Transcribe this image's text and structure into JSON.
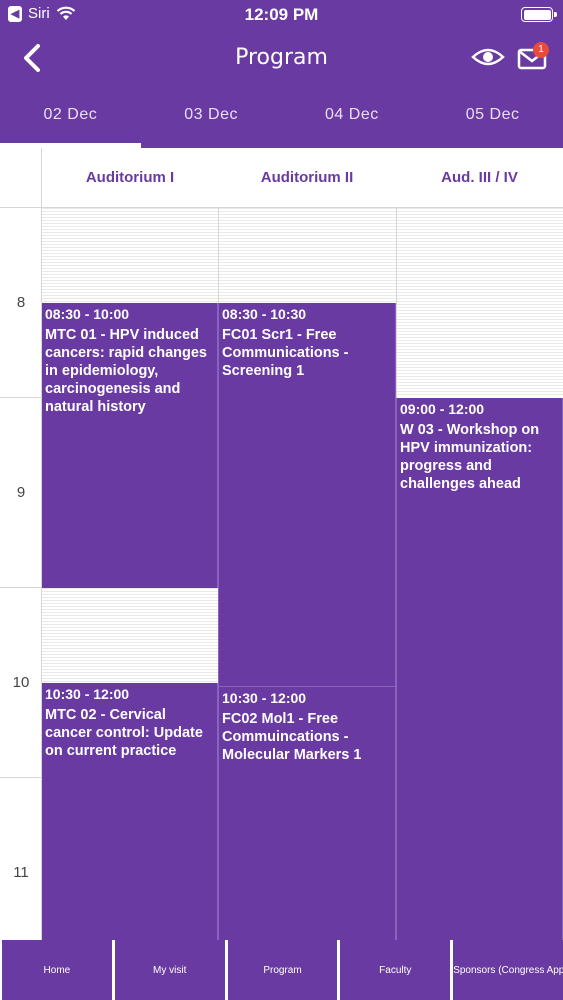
{
  "status_bar": {
    "carrier": "Siri",
    "time": "12:09 PM"
  },
  "header": {
    "title": "Program",
    "notification_count": "1"
  },
  "date_tabs": [
    "02 Dec",
    "03 Dec",
    "04 Dec",
    "05 Dec"
  ],
  "auditoriums": [
    "Auditorium I",
    "Auditorium II",
    "Aud. III / IV"
  ],
  "hours": [
    "8",
    "9",
    "10",
    "11"
  ],
  "events": [
    {
      "time": "08:30 - 10:00",
      "title": "MTC 01 - HPV induced cancers: rapid changes in epidemiology, carcinogenesis and natural history"
    },
    {
      "time": "10:30 - 12:00",
      "title": "MTC 02 - Cervical cancer control: Update on current practice"
    },
    {
      "time": "08:30 - 10:30",
      "title": "FC01 Scr1 - Free Communications - Screening 1"
    },
    {
      "time": "10:30 - 12:00",
      "title": "FC02 Mol1 - Free Commuincations - Molecular Markers 1"
    },
    {
      "time": "09:00 - 12:00",
      "title": "W 03 - Workshop on HPV immunization: progress and challenges ahead"
    }
  ],
  "bottom_nav": [
    "Home",
    "My visit",
    "Program",
    "Faculty",
    "Sponsors (Congress App)"
  ],
  "colors": {
    "accent": "#6a3aa3",
    "badge": "#e84a3c"
  }
}
